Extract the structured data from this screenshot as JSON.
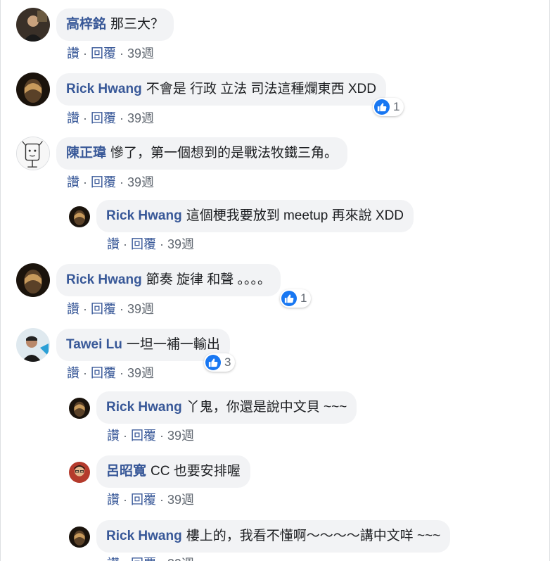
{
  "actions": {
    "like": "讚",
    "reply": "回覆",
    "sep": "·",
    "time": "39週"
  },
  "comments": [
    {
      "author": "高梓銘",
      "text": "那三大？"
    },
    {
      "author": "Rick Hwang",
      "text": "不會是 行政 立法 司法這種爛東西 XDD",
      "likes": "1"
    },
    {
      "author": "陳正瑋",
      "text": "慘了，第一個想到的是戰法牧鐵三角。"
    },
    {
      "author": "Rick Hwang",
      "text": "這個梗我要放到 meetup 再來說 XDD"
    },
    {
      "author": "Rick Hwang",
      "text": "節奏 旋律 和聲 。。。。",
      "likes": "1"
    },
    {
      "author": "Tawei Lu",
      "text": "一坦一補一輸出",
      "likes": "3"
    },
    {
      "author": "Rick Hwang",
      "text": "丫鬼，你還是說中文貝 ~~~"
    },
    {
      "author": "呂昭寬",
      "text": "CC 也要安排喔"
    },
    {
      "author": "Rick Hwang",
      "text": "樓上的，我看不懂啊～～～～講中文咩 ~~~"
    }
  ],
  "colors": {
    "link": "#385898",
    "bubble": "#f2f3f5",
    "like": "#1877f2",
    "meta": "#606770"
  }
}
